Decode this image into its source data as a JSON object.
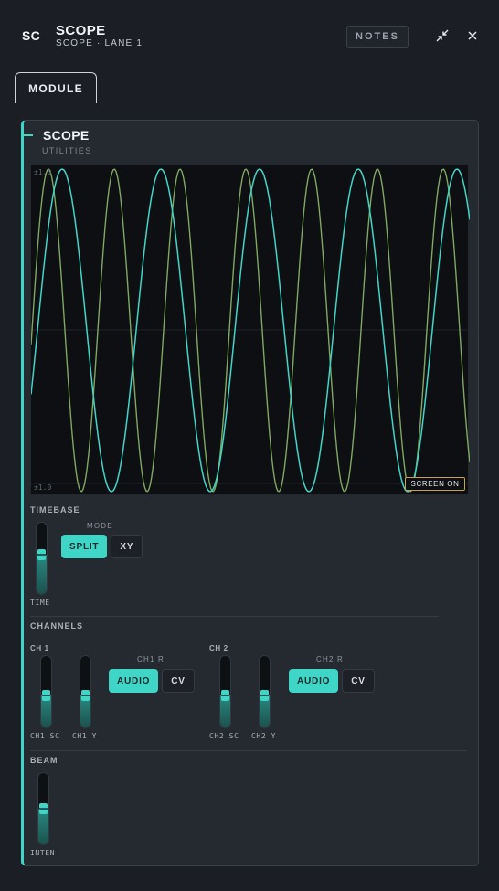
{
  "header": {
    "code": "SC",
    "title": "SCOPE",
    "subtitle": "SCOPE · LANE 1",
    "notes_label": "NOTES"
  },
  "tabs": [
    {
      "label": "MODULE"
    }
  ],
  "module": {
    "title": "SCOPE",
    "category": "UTILITIES",
    "accent_color": "#3fd6c8"
  },
  "scope_display": {
    "scale_top": "±1.0",
    "scale_bottom": "±1.0",
    "screen_label": "SCREEN ON",
    "trace_colors": [
      "#3fd6c8",
      "#7fa862"
    ]
  },
  "timebase": {
    "section_label": "TIMEBASE",
    "time_label": "TIME",
    "time_level": 0.55,
    "mode_label": "MODE",
    "mode_options": [
      "SPLIT",
      "XY"
    ],
    "mode_selected": "SPLIT"
  },
  "channels": {
    "section_label": "CHANNELS",
    "ch1": {
      "group_label": "CH 1",
      "fader_sc_label": "CH1 SC",
      "fader_sc_level": 0.45,
      "fader_y_label": "CH1 Y",
      "fader_y_level": 0.45,
      "r_label": "CH1 R",
      "r_options": [
        "AUDIO",
        "CV"
      ],
      "r_selected": "AUDIO"
    },
    "ch2": {
      "group_label": "CH 2",
      "fader_sc_label": "CH2 SC",
      "fader_sc_level": 0.45,
      "fader_y_label": "CH2 Y",
      "fader_y_level": 0.45,
      "r_label": "CH2 R",
      "r_options": [
        "AUDIO",
        "CV"
      ],
      "r_selected": "AUDIO"
    }
  },
  "beam": {
    "section_label": "BEAM",
    "inten_label": "INTEN",
    "inten_level": 0.5
  }
}
